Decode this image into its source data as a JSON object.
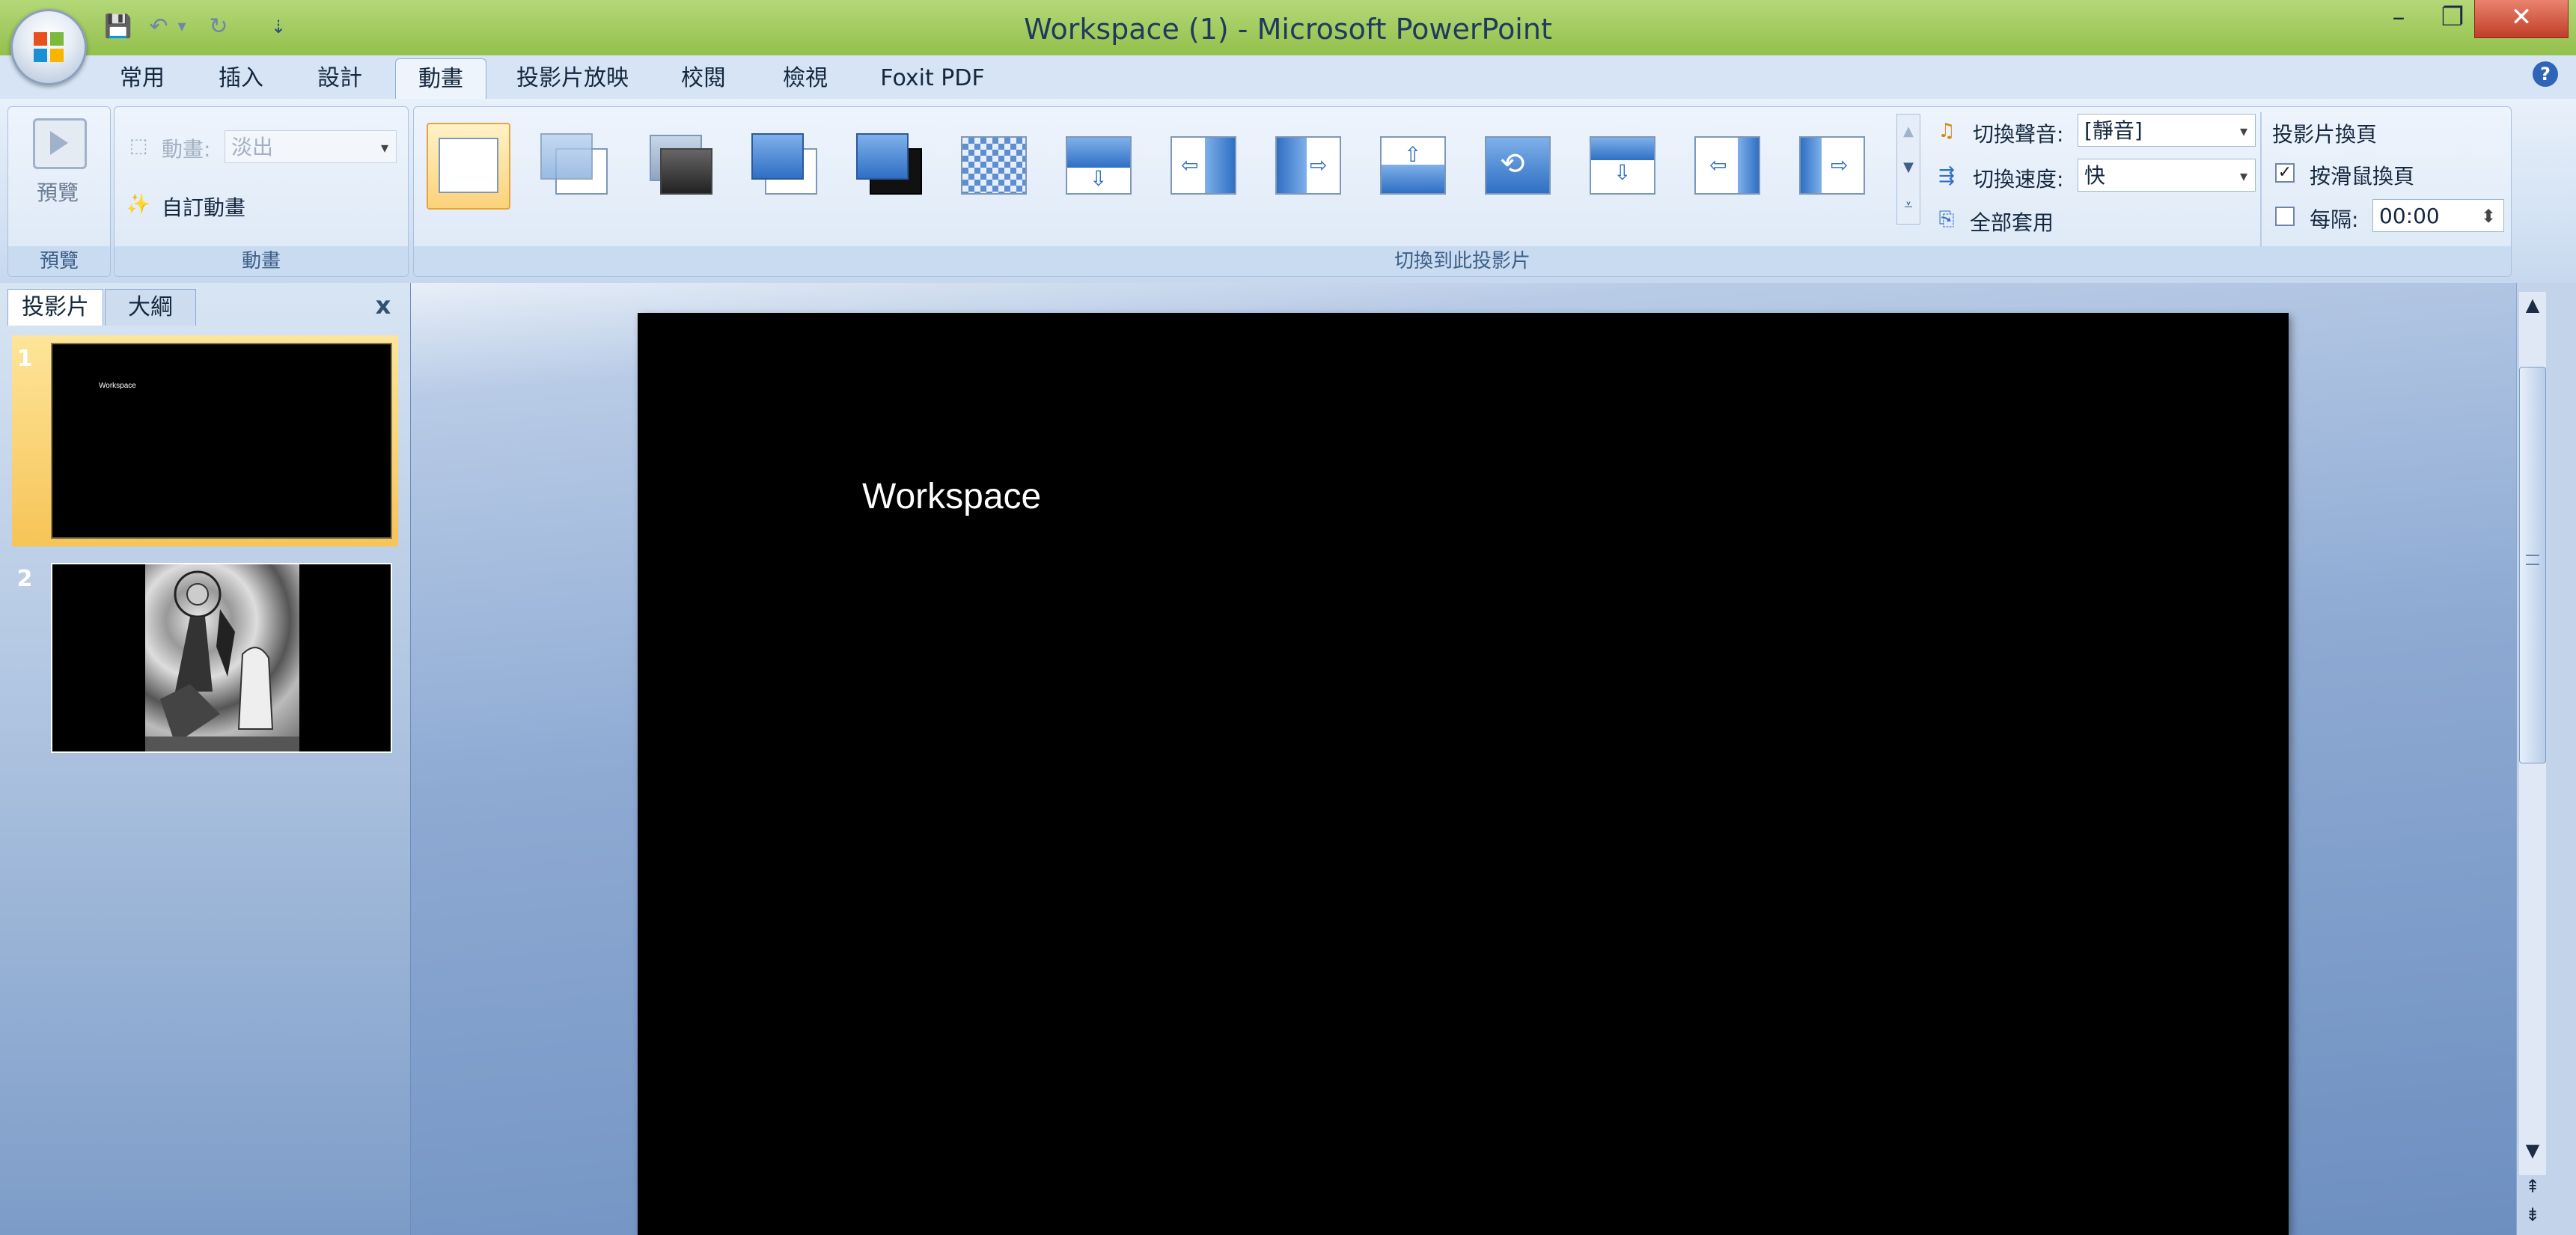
{
  "window": {
    "title": "Workspace (1) - Microsoft PowerPoint",
    "controls": [
      "–",
      "❐",
      "✕"
    ]
  },
  "quick_access": {
    "save_glyph": "💾",
    "undo_glyph": "↶",
    "undo_dropdown": "▾",
    "redo_glyph": "↻",
    "customize_glyph": "⇣"
  },
  "ribbon_tabs": [
    {
      "label": "常用"
    },
    {
      "label": "插入"
    },
    {
      "label": "設計"
    },
    {
      "label": "動畫"
    },
    {
      "label": "投影片放映"
    },
    {
      "label": "校閱"
    },
    {
      "label": "檢視"
    },
    {
      "label": "Foxit PDF"
    }
  ],
  "groups": {
    "preview": {
      "button_label": "預覽",
      "group_label": "預覽"
    },
    "animations": {
      "animate_label": "動畫:",
      "animate_value": "淡出",
      "custom_label": "自訂動畫",
      "group_label": "動畫"
    },
    "transitions": {
      "group_label": "切換到此投影片"
    },
    "transition_options": {
      "sound_label": "切換聲音:",
      "sound_value": "[靜音]",
      "speed_label": "切換速度:",
      "speed_value": "快",
      "apply_all_label": "全部套用"
    },
    "advance_slide": {
      "title": "投影片換頁",
      "on_click_label": "按滑鼠換頁",
      "on_click_checked": true,
      "after_label": "每隔:",
      "after_checked": false,
      "after_value": "00:00"
    }
  },
  "slides_panel": {
    "tabs": [
      {
        "label": "投影片"
      },
      {
        "label": "大綱"
      }
    ],
    "close_glyph": "x",
    "slides": [
      {
        "number": "1",
        "thumb_title": "Workspace"
      },
      {
        "number": "2"
      }
    ]
  },
  "slide": {
    "title": "Workspace"
  },
  "colors": {
    "title_bar": "#9dc75b",
    "ribbon": "#dce8f6",
    "selection": "#f7c457",
    "slide_bg": "#000000",
    "close_button": "#c13e27"
  }
}
